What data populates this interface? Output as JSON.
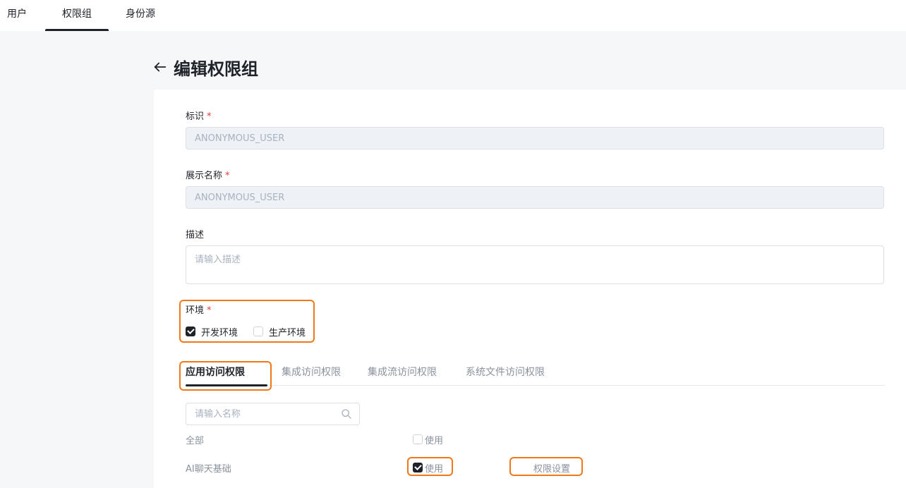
{
  "nav": {
    "tabs": [
      {
        "label": "用户"
      },
      {
        "label": "权限组"
      },
      {
        "label": "身份源"
      }
    ]
  },
  "header": {
    "title": "编辑权限组"
  },
  "form": {
    "identifier": {
      "label": "标识",
      "required_mark": "*",
      "value": "ANONYMOUS_USER"
    },
    "display_name": {
      "label": "展示名称",
      "required_mark": "*",
      "value": "ANONYMOUS_USER"
    },
    "description": {
      "label": "描述",
      "placeholder": "请输入描述"
    },
    "environment": {
      "label": "环境",
      "required_mark": "*",
      "options": [
        {
          "label": "开发环境",
          "checked": true
        },
        {
          "label": "生产环境",
          "checked": false
        }
      ]
    }
  },
  "permission_tabs": [
    {
      "label": "应用访问权限",
      "active": true
    },
    {
      "label": "集成访问权限",
      "active": false
    },
    {
      "label": "集成流访问权限",
      "active": false
    },
    {
      "label": "系统文件访问权限",
      "active": false
    }
  ],
  "search": {
    "placeholder": "请输入名称"
  },
  "rows": [
    {
      "name": "全部",
      "use_label": "使用",
      "use_checked": false
    },
    {
      "name": "AI聊天基础",
      "use_label": "使用",
      "use_checked": true,
      "settings_label": "权限设置"
    }
  ],
  "colors": {
    "highlight": "#f07818",
    "required": "#e53935",
    "primary": "#1f2329"
  }
}
